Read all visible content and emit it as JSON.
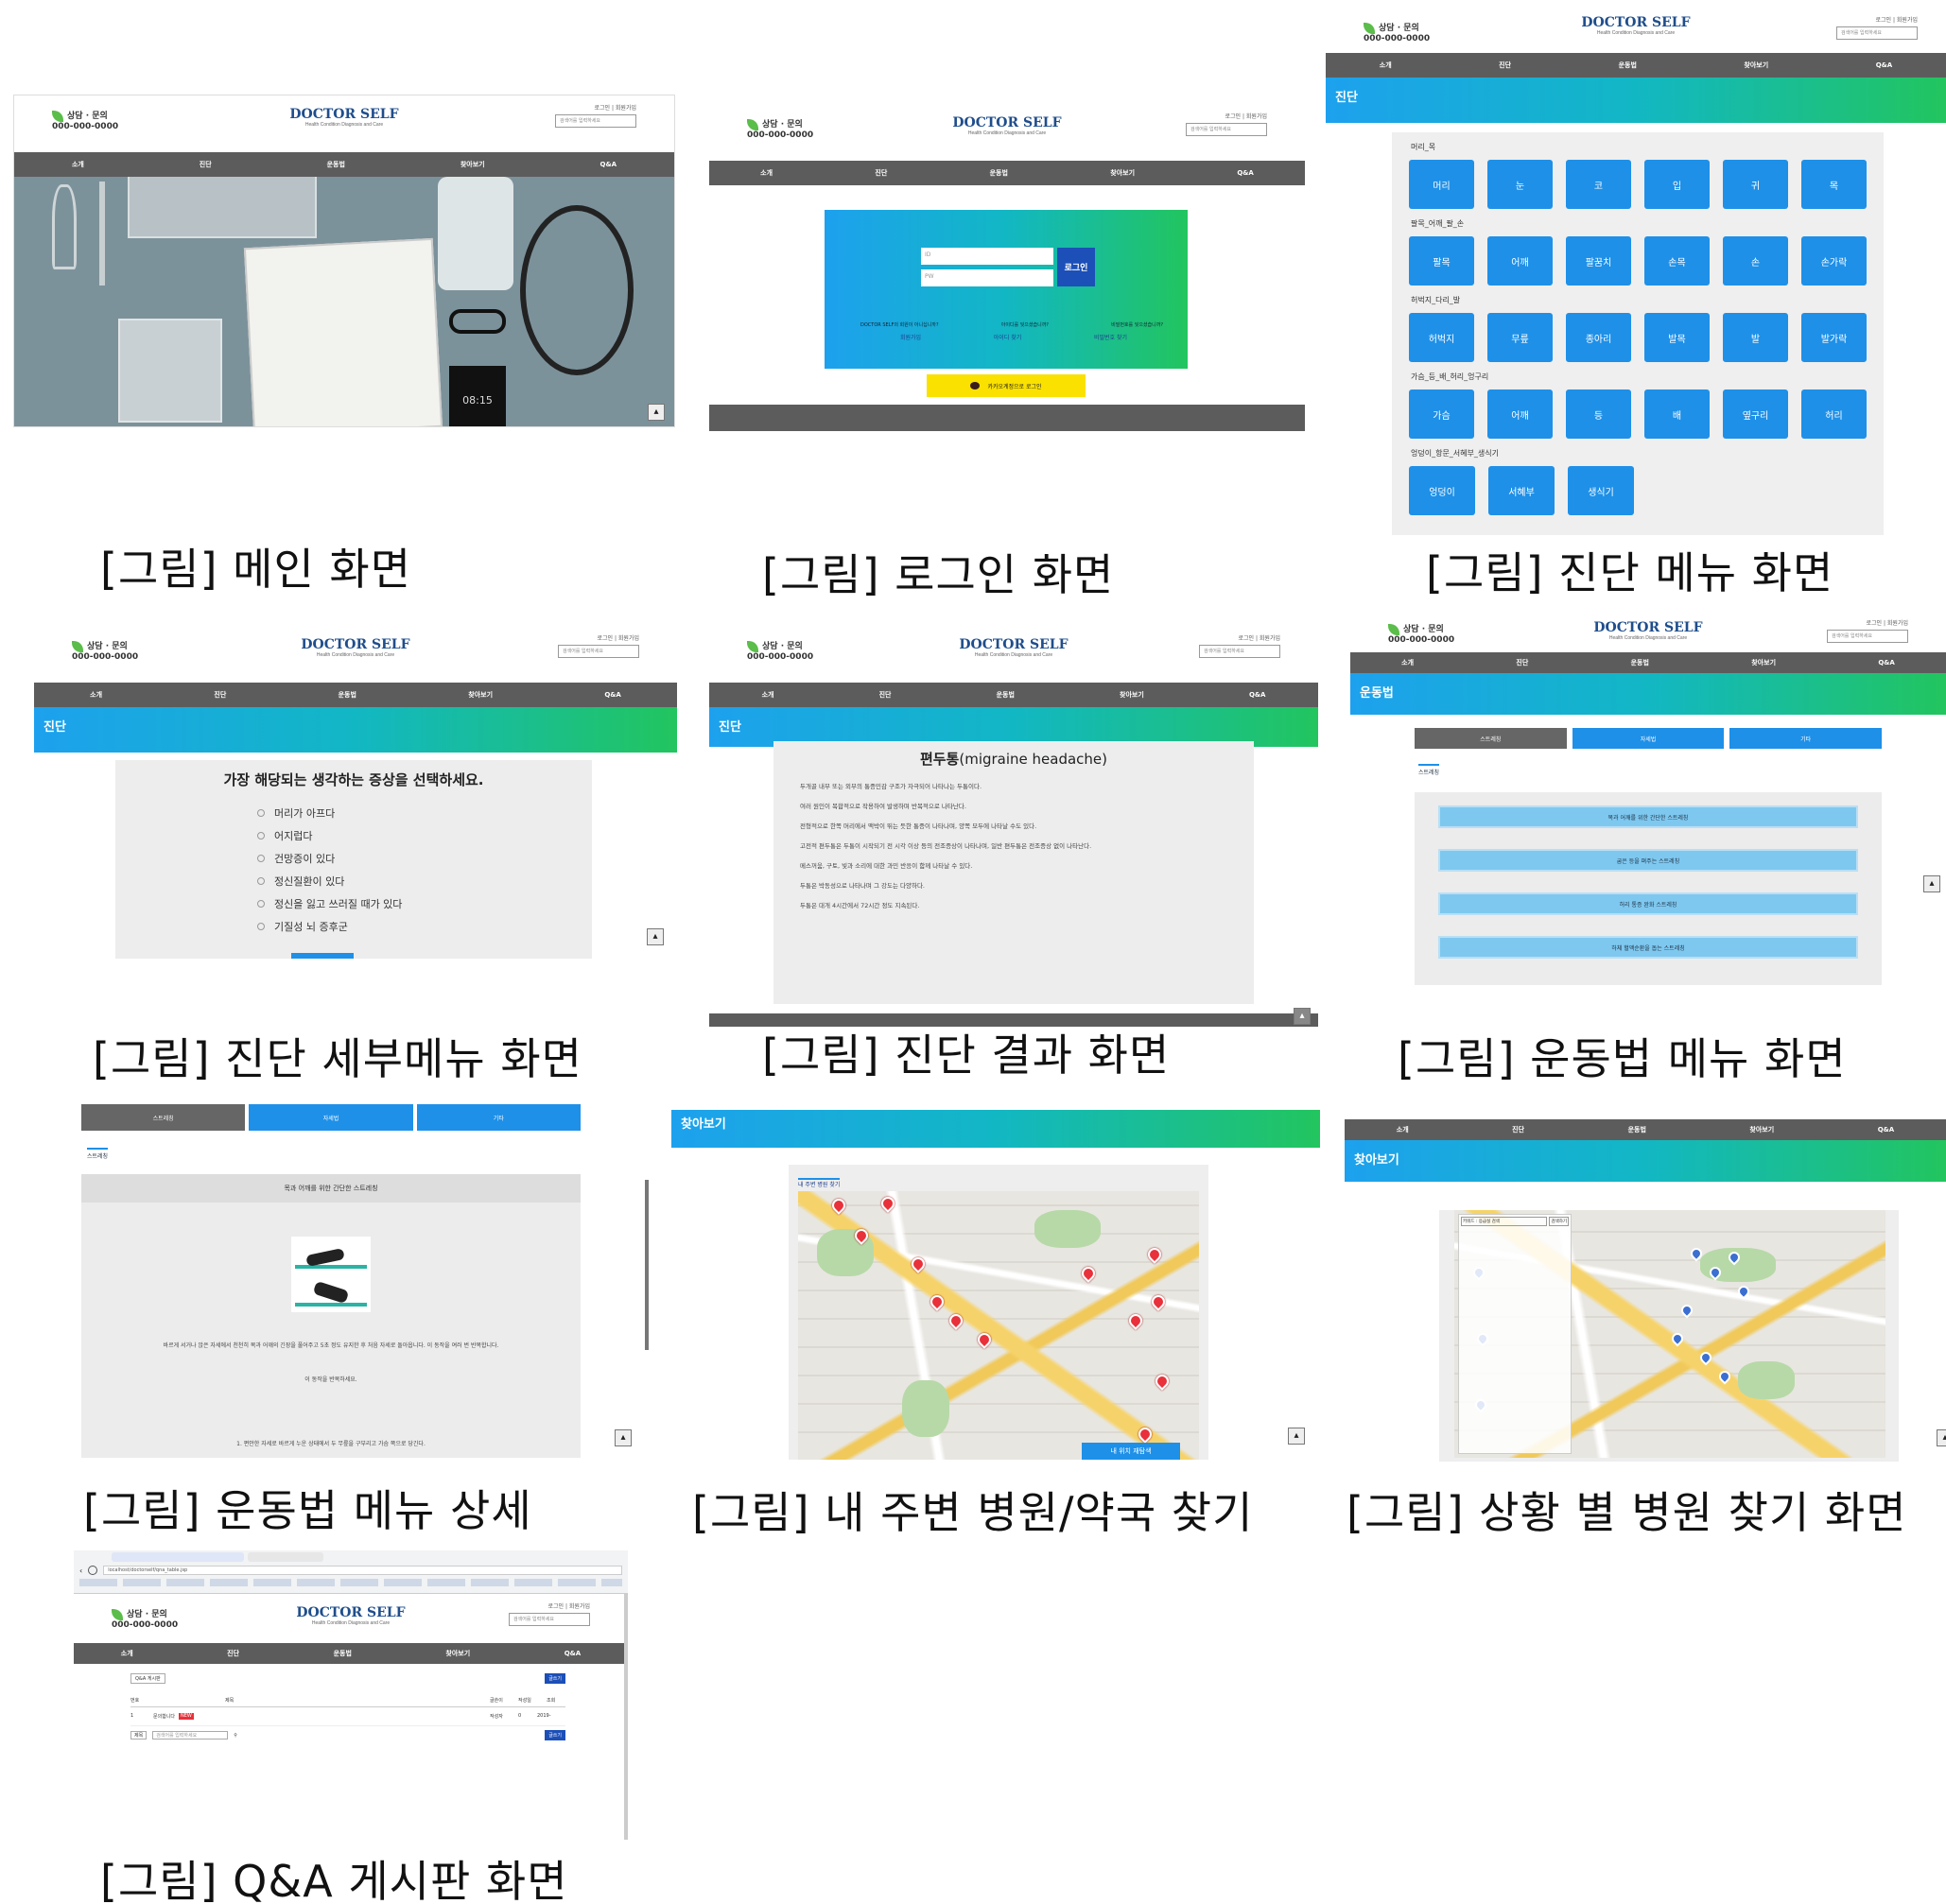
{
  "captions": [
    "[그림] 메인 화면",
    "[그림] 로그인 화면",
    "[그림] 진단 메뉴 화면",
    "[그림] 진단 세부메뉴 화면",
    "[그림] 진단 결과 화면",
    "[그림] 운동법 메뉴 화면",
    "[그림] 운동법 메뉴 상세",
    "[그림] 내 주변 병원/약국 찾기",
    "[그림] 상황 별 병원 찾기 화면",
    "[그림] Q&A 게시판 화면"
  ],
  "site": {
    "phone_label": "상담 · 문의",
    "phone": "000-000-0000",
    "brand": "DOCTOR SELF",
    "tagline": "Health Condition Diagnosis and Care",
    "util": "로그인 | 회원가입",
    "search_placeholder": "검색어를 입력하세요"
  },
  "nav": [
    "소개",
    "진단",
    "운동법",
    "찾아보기",
    "Q&A"
  ],
  "main": {
    "clock": "08:15"
  },
  "login": {
    "id_placeholder": "ID",
    "pw_placeholder": "PW",
    "login_button": "로그인",
    "prompt1": "DOCTOR SELF의 회원이 아니십니까?",
    "prompt2": "아이디를 잊으셨습니까?",
    "prompt3": "비밀번호를 잊으셨습니까?",
    "signup": "회원가입",
    "find_id": "아이디 찾기",
    "find_pw": "비밀번호 찾기",
    "kakao": "카카오계정으로 로그인"
  },
  "diag_menu": {
    "section": "진단",
    "cat1": "머리_목",
    "row1": [
      "머리",
      "눈",
      "코",
      "입",
      "귀",
      "목"
    ],
    "cat2": "팔목_어깨_팔_손",
    "row2": [
      "팔목",
      "어깨",
      "팔꿈치",
      "손목",
      "손",
      "손가락"
    ],
    "cat3": "허벅지_다리_발",
    "row3": [
      "허벅지",
      "무릎",
      "종아리",
      "발목",
      "발",
      "발가락"
    ],
    "cat4": "가슴_등_배_허리_엉구리",
    "row4": [
      "가슴",
      "어깨",
      "등",
      "배",
      "옆구리",
      "허리"
    ],
    "cat5": "엉덩이_항문_서혜부_생식기",
    "row5": [
      "엉덩이",
      "서혜부",
      "생식기"
    ]
  },
  "diag_detail": {
    "section": "진단",
    "question": "가장 해당되는 생각하는 증상을 선택하세요.",
    "options": [
      "머리가 아프다",
      "어지럽다",
      "건망증이 있다",
      "정신질환이 있다",
      "정신을 잃고 쓰러질 때가 있다",
      "기질성 뇌 증후군"
    ]
  },
  "diag_result": {
    "section": "진단",
    "title": "편두통",
    "title_en": "(migraine headache)",
    "paras": [
      "두개골 내부 또는 외부의 통증민감 구조가 자극되어 나타나는 두통이다.",
      "여러 원인이 복합적으로 작용하여 발생하며 반복적으로 나타난다.",
      "전형적으로 한쪽 머리에서 맥박이 뛰는 듯한 통증이 나타나며, 양쪽 모두에 나타날 수도 있다.",
      "고전적 편두통은 두통이 시작되기 전 시각 이상 등의 전조증상이 나타나며, 일반 편두통은 전조증상 없이 나타난다.",
      "메스꺼움, 구토, 빛과 소리에 대한 과민 반응이 함께 나타날 수 있다.",
      "두통은 박동성으로 나타나며 그 강도는 다양하다.",
      "두통은 대개 4시간에서 72시간 정도 지속된다."
    ]
  },
  "exercise": {
    "section": "운동법",
    "tabs": [
      "스트레칭",
      "자세법",
      "기타"
    ],
    "sub": "스트레칭",
    "items": [
      "목과 어깨를 위한 간단한 스트레칭",
      "굽은 등을 펴주는 스트레칭",
      "허리 통증 완화 스트레칭",
      "하체 혈액순환을 돕는 스트레칭"
    ]
  },
  "exercise_detail": {
    "tabs": [
      "스트레칭",
      "자세법",
      "기타"
    ],
    "sub": "스트레칭",
    "title": "목과 어깨를 위한 간단한 스트레칭",
    "desc1": "바르게 서거나 앉은 자세에서 천천히 목과 어깨의 긴장을 풀어주고 5초 정도 유지한 후 처음 자세로 돌아옵니다. 이 동작을 여러 번 반복합니다.",
    "desc2": "이 동작을 반복하세요.",
    "step1": "1. 편안한 자세로 바르게 누운 상태에서 두 무릎을 구부리고 가슴 쪽으로 당긴다."
  },
  "nearby": {
    "section": "찾아보기",
    "label": "내 주변 병원 찾기",
    "button": "내 위치 재탐색"
  },
  "situation": {
    "section": "찾아보기",
    "search_value": "키워드 : 응급실 검색",
    "search_button": "검색하기"
  },
  "qna": {
    "url": "localhost/doctorself/qna_table.jsp",
    "write": "글쓰기",
    "board_label": "Q&A 게시판",
    "cols": [
      "번호",
      "제목",
      "글쓴이",
      "작성일",
      "조회"
    ],
    "row": {
      "no": "1",
      "title": "문의합니다",
      "badge": "NEW",
      "author": "작성자",
      "date": "2019-",
      "views": "0"
    },
    "search_select": "제목",
    "search_placeholder": "검색어를 입력하세요",
    "search_button": "검색"
  }
}
